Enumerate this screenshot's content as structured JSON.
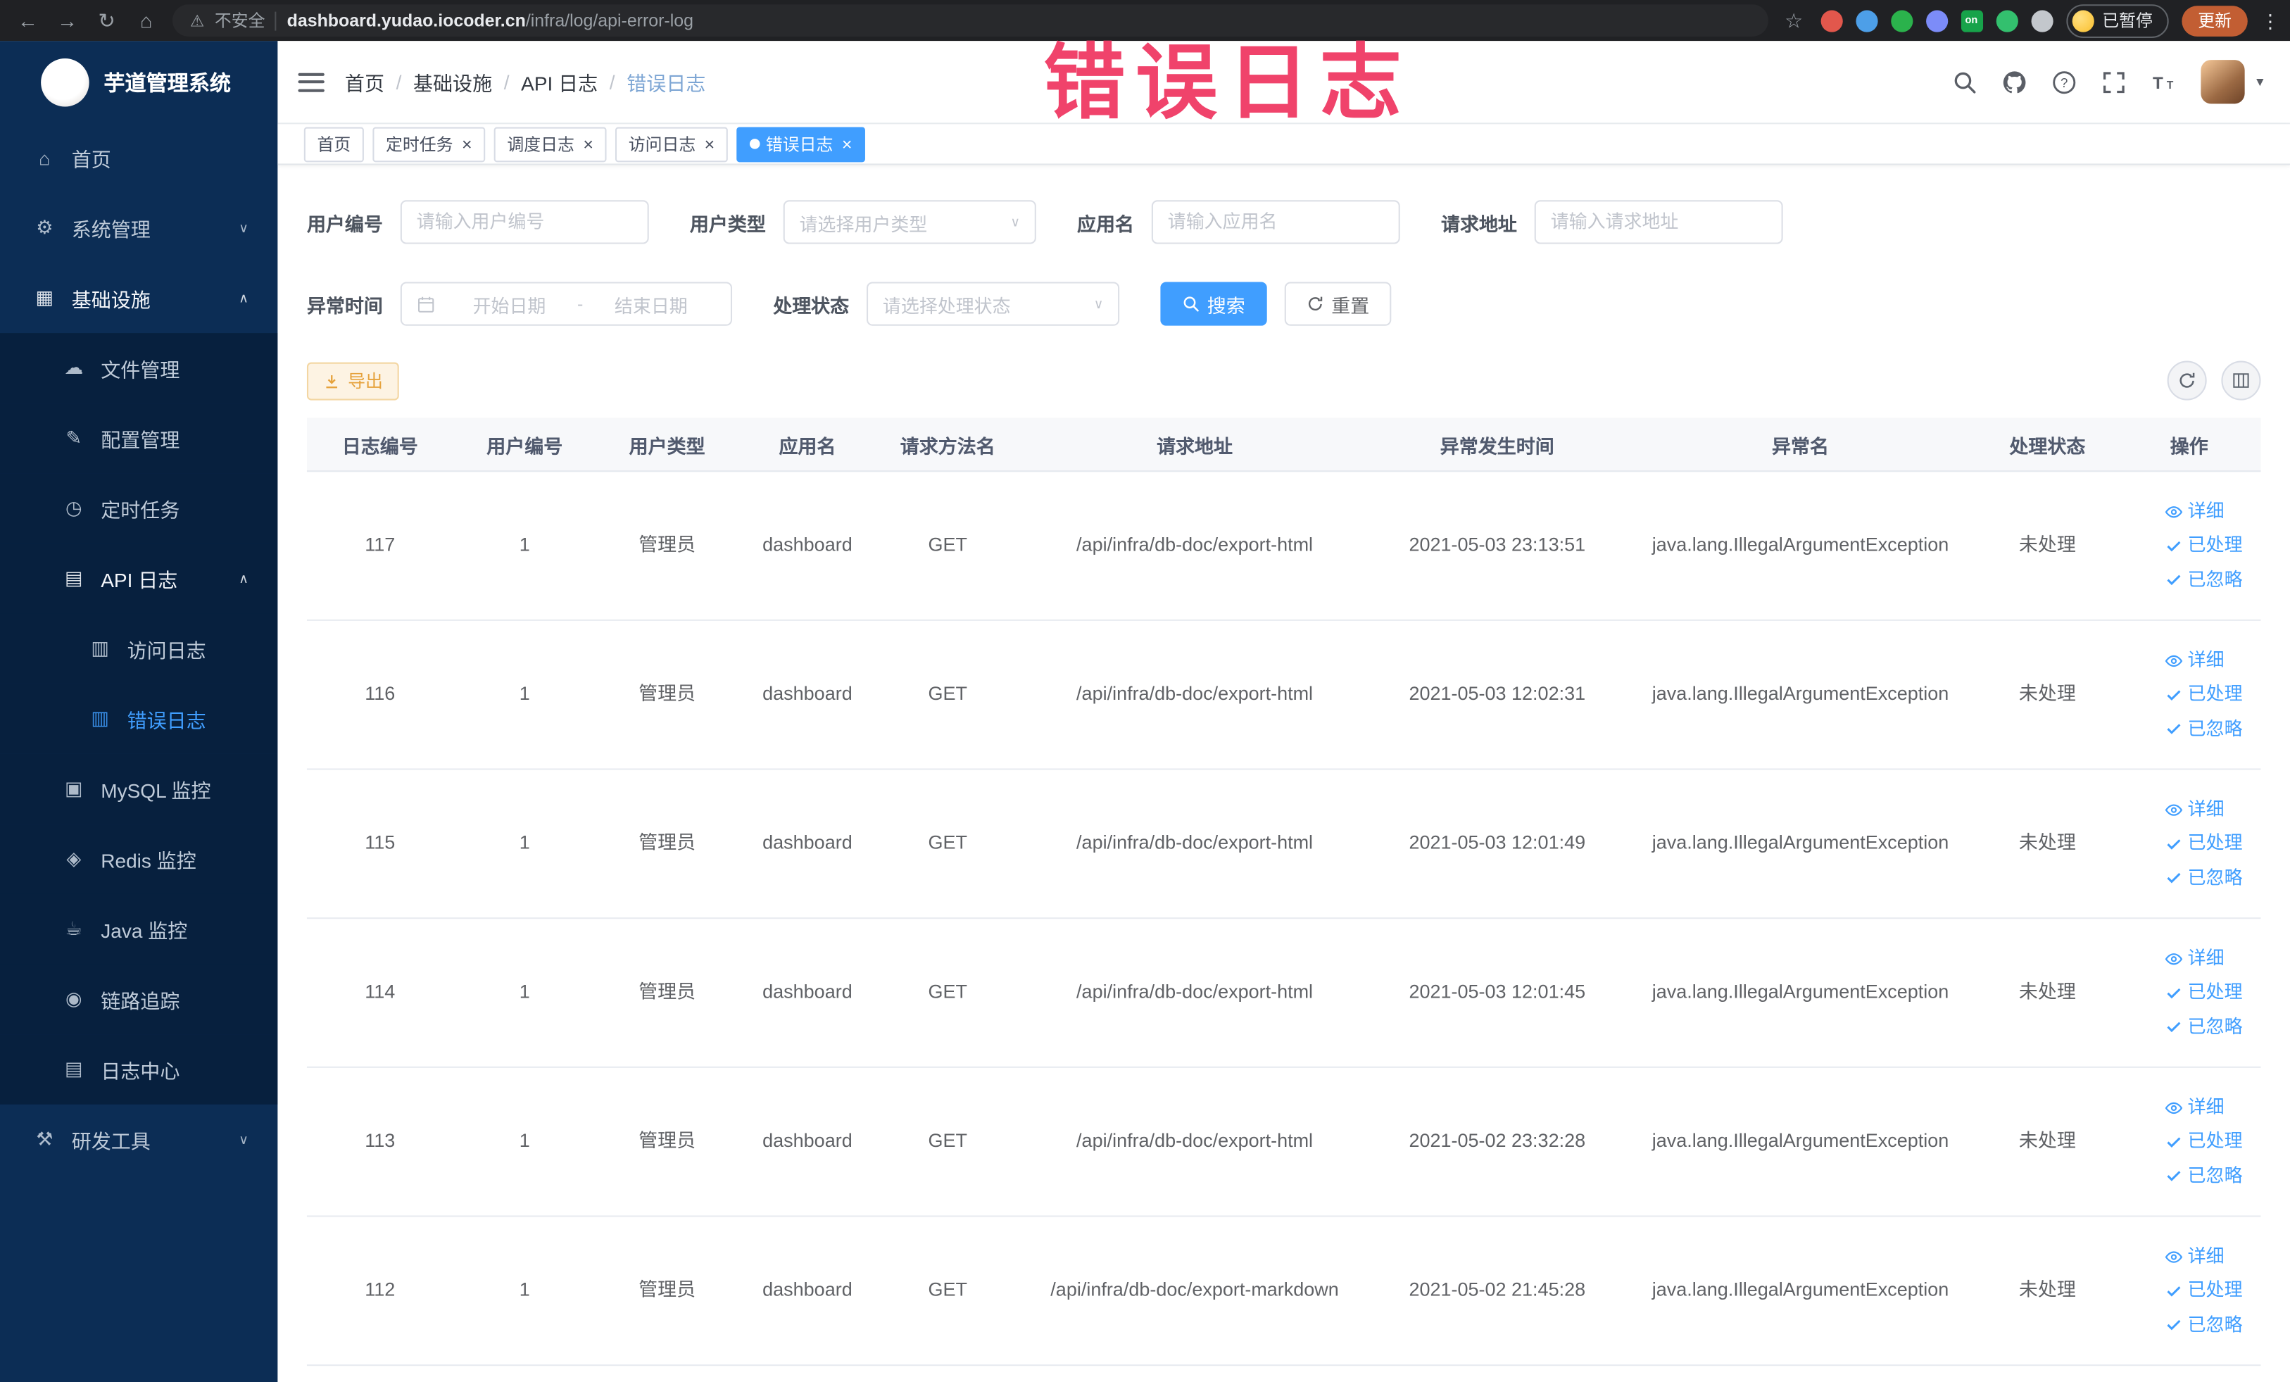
{
  "browser": {
    "security_label": "不安全",
    "url_host": "dashboard.yudao.iocoder.cn",
    "url_path": "/infra/log/api-error-log",
    "paused_label": "已暂停",
    "update_label": "更新",
    "extensions": [
      {
        "id": "ext-red",
        "color": "#e2574c"
      },
      {
        "id": "ext-blue",
        "color": "#4d9fe8"
      },
      {
        "id": "ext-green",
        "color": "#2bb24c"
      },
      {
        "id": "ext-indigo",
        "color": "#7c8cf8"
      },
      {
        "id": "ext-on",
        "color": "#17a34a",
        "text": "on",
        "shape": "square"
      },
      {
        "id": "ext-leaf",
        "color": "#33c06e"
      },
      {
        "id": "ext-gray",
        "color": "#c3c7cc"
      }
    ]
  },
  "annotation": {
    "text": "错误日志"
  },
  "sidebar": {
    "title": "芋道管理系统",
    "items": [
      {
        "id": "home",
        "label": "首页",
        "icon": "home",
        "level": 1
      },
      {
        "id": "system",
        "label": "系统管理",
        "icon": "gear",
        "level": 1,
        "arrow": "down"
      },
      {
        "id": "infra",
        "label": "基础设施",
        "icon": "grid",
        "level": 1,
        "arrow": "up",
        "open": true
      },
      {
        "id": "file",
        "label": "文件管理",
        "icon": "cloud",
        "level": 2
      },
      {
        "id": "config",
        "label": "配置管理",
        "icon": "edit",
        "level": 2
      },
      {
        "id": "job",
        "label": "定时任务",
        "icon": "timer",
        "level": 2
      },
      {
        "id": "api-log",
        "label": "API 日志",
        "icon": "doc",
        "level": 2,
        "arrow": "up",
        "open": true
      },
      {
        "id": "access-log",
        "label": "访问日志",
        "icon": "doc2",
        "level": 3
      },
      {
        "id": "error-log",
        "label": "错误日志",
        "icon": "doc2",
        "level": 3,
        "active": true
      },
      {
        "id": "mysql",
        "label": "MySQL 监控",
        "icon": "db",
        "level": 2
      },
      {
        "id": "redis",
        "label": "Redis 监控",
        "icon": "redis",
        "level": 2
      },
      {
        "id": "java",
        "label": "Java 监控",
        "icon": "java",
        "level": 2
      },
      {
        "id": "trace",
        "label": "链路追踪",
        "icon": "trace",
        "level": 2
      },
      {
        "id": "log-center",
        "label": "日志中心",
        "icon": "log",
        "level": 2
      },
      {
        "id": "dev-tools",
        "label": "研发工具",
        "icon": "tool",
        "level": 1,
        "arrow": "down"
      }
    ]
  },
  "navbar": {
    "breadcrumb": [
      "首页",
      "基础设施",
      "API 日志",
      "错误日志"
    ],
    "separator": "/"
  },
  "tags": [
    {
      "id": "home",
      "label": "首页",
      "closable": false,
      "active": false
    },
    {
      "id": "job",
      "label": "定时任务",
      "closable": true,
      "active": false
    },
    {
      "id": "job-log",
      "label": "调度日志",
      "closable": true,
      "active": false
    },
    {
      "id": "access-log",
      "label": "访问日志",
      "closable": true,
      "active": false
    },
    {
      "id": "error-log",
      "label": "错误日志",
      "closable": true,
      "active": true
    }
  ],
  "filters": {
    "fields": [
      {
        "id": "user-id",
        "row": 0,
        "type": "input",
        "label": "用户编号",
        "placeholder": "请输入用户编号"
      },
      {
        "id": "user-type",
        "row": 0,
        "type": "select",
        "label": "用户类型",
        "placeholder": "请选择用户类型"
      },
      {
        "id": "app-name",
        "row": 0,
        "type": "input",
        "label": "应用名",
        "placeholder": "请输入应用名"
      },
      {
        "id": "request-url",
        "row": 0,
        "type": "input",
        "label": "请求地址",
        "placeholder": "请输入请求地址"
      },
      {
        "id": "exception-time",
        "row": 1,
        "type": "daterange",
        "label": "异常时间",
        "start_placeholder": "开始日期",
        "end_placeholder": "结束日期",
        "separator": "-"
      },
      {
        "id": "process-status",
        "row": 1,
        "type": "select",
        "label": "处理状态",
        "placeholder": "请选择处理状态"
      }
    ],
    "search_label": "搜索",
    "reset_label": "重置"
  },
  "toolbar": {
    "export_label": "导出"
  },
  "table": {
    "columns": [
      "日志编号",
      "用户编号",
      "用户类型",
      "应用名",
      "请求方法名",
      "请求地址",
      "异常发生时间",
      "异常名",
      "处理状态",
      "操作"
    ],
    "column_keys": [
      "log_id",
      "user_id",
      "user_type",
      "app_name",
      "method",
      "url",
      "time",
      "exception",
      "status"
    ],
    "actions": [
      {
        "id": "detail",
        "label": "详细",
        "icon": "eye"
      },
      {
        "id": "processed",
        "label": "已处理",
        "icon": "check"
      },
      {
        "id": "ignored",
        "label": "已忽略",
        "icon": "check"
      }
    ],
    "rows": [
      {
        "log_id": "117",
        "user_id": "1",
        "user_type": "管理员",
        "app_name": "dashboard",
        "method": "GET",
        "url": "/api/infra/db-doc/export-html",
        "time": "2021-05-03 23:13:51",
        "exception": "java.lang.IllegalArgumentException",
        "status": "未处理"
      },
      {
        "log_id": "116",
        "user_id": "1",
        "user_type": "管理员",
        "app_name": "dashboard",
        "method": "GET",
        "url": "/api/infra/db-doc/export-html",
        "time": "2021-05-03 12:02:31",
        "exception": "java.lang.IllegalArgumentException",
        "status": "未处理"
      },
      {
        "log_id": "115",
        "user_id": "1",
        "user_type": "管理员",
        "app_name": "dashboard",
        "method": "GET",
        "url": "/api/infra/db-doc/export-html",
        "time": "2021-05-03 12:01:49",
        "exception": "java.lang.IllegalArgumentException",
        "status": "未处理"
      },
      {
        "log_id": "114",
        "user_id": "1",
        "user_type": "管理员",
        "app_name": "dashboard",
        "method": "GET",
        "url": "/api/infra/db-doc/export-html",
        "time": "2021-05-03 12:01:45",
        "exception": "java.lang.IllegalArgumentException",
        "status": "未处理"
      },
      {
        "log_id": "113",
        "user_id": "1",
        "user_type": "管理员",
        "app_name": "dashboard",
        "method": "GET",
        "url": "/api/infra/db-doc/export-html",
        "time": "2021-05-02 23:32:28",
        "exception": "java.lang.IllegalArgumentException",
        "status": "未处理"
      },
      {
        "log_id": "112",
        "user_id": "1",
        "user_type": "管理员",
        "app_name": "dashboard",
        "method": "GET",
        "url": "/api/infra/db-doc/export-markdown",
        "time": "2021-05-02 21:45:28",
        "exception": "java.lang.IllegalArgumentException",
        "status": "未处理"
      }
    ]
  }
}
